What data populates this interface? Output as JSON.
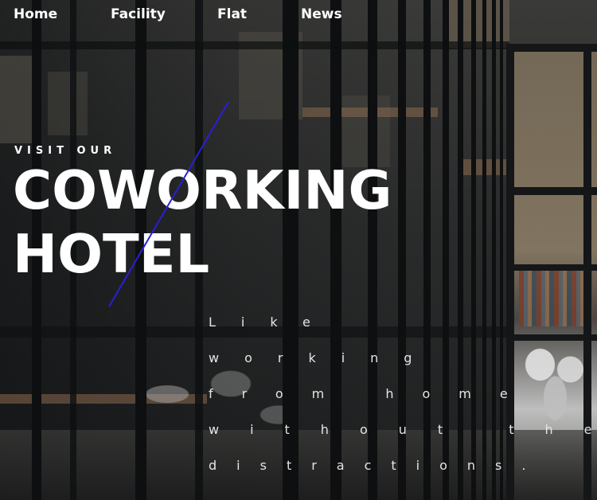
{
  "nav": {
    "items": [
      {
        "label": "Home"
      },
      {
        "label": "Facility"
      },
      {
        "label": "Flat"
      },
      {
        "label": "News"
      }
    ]
  },
  "hero": {
    "eyebrow": "VISIT OUR",
    "headline_line1": "COWORKING",
    "headline_line2": "HOTEL",
    "tagline_lines": [
      "Like",
      "working",
      "from home",
      "without the",
      "distractions."
    ]
  },
  "colors": {
    "text": "#ffffff",
    "accent_line": "#2a1fd6",
    "tagline_text": "#e4e4e4"
  }
}
